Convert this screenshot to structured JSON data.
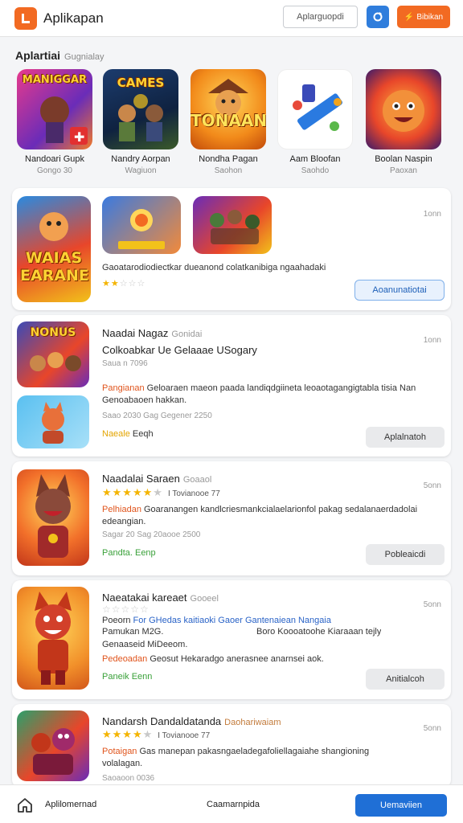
{
  "header": {
    "title": "Aplikapan",
    "search_placeholder": "Aplarguopdi",
    "cta_label": "Bibikan"
  },
  "section": {
    "title": "Aplartiai",
    "subtitle": "Gugnialay"
  },
  "featured": [
    {
      "name": "Nandoari Gupk",
      "sub": "Gongo 30",
      "art": "MANIGGAR"
    },
    {
      "name": "Nandry Aorpan",
      "sub": "Wagiuon",
      "art": "CAMES"
    },
    {
      "name": "Nondha Pagan",
      "sub": "Saohon",
      "art": "TONAAN"
    },
    {
      "name": "Aam Bloofan",
      "sub": "Saohdo",
      "art": ""
    },
    {
      "name": "Boolan Naspin",
      "sub": "Paoxan",
      "art": ""
    }
  ],
  "card1": {
    "time": "1onn",
    "big_art": "WAIAS EARANE",
    "small_art_1": "",
    "desc": "Gaoatarodiodiectkar dueanond colatkanibiga ngaahadaki",
    "stars": {
      "filled": "★★",
      "empty": "☆☆☆",
      "value": 2
    },
    "button": "Aoanunatiotai"
  },
  "card2": {
    "time": "1onn",
    "art_text": "NONUS",
    "title": "Naadai Nagaz",
    "title_muted": "Gonidai",
    "subtitle": "Colkoabkar Ue Gelaaae USogary",
    "meta": "Saua n 7096",
    "tag": "Pangianan",
    "desc1": "Geloaraen maeon paada landiqdgiineta leoaotagangigtabla tisia Nan",
    "desc2": "Genoabaoen hakkan.",
    "meta2": "Saao 2030 Gag Gegener 2250",
    "tag2": "Naeale",
    "tag2_text": "Eeqh",
    "button": "Aplalnatoh"
  },
  "card3": {
    "time": "5onn",
    "title": "Naadalai Saraen",
    "title_muted": "Goaaol",
    "stars": {
      "filled": "★★★★★",
      "empty": "★",
      "value": 5,
      "review": "I Tovianooe 77"
    },
    "tag": "Pelhiadan",
    "desc1": "Goaranangen kandlcriesmankcialaelarionfol pakag sedalanaerdadolai",
    "desc2": "edeangian.",
    "meta": "Sagar 20 Sag 20aooe 2500",
    "tag2": "Pandta. Eenp",
    "button": "Pobleaicdi"
  },
  "card4": {
    "time": "5onn",
    "title": "Naeatakai kareaet",
    "title_muted": "Gooeel",
    "stars": {
      "filled": "",
      "empty": "☆☆☆☆☆",
      "value": 0
    },
    "line1a": "Poeorn",
    "line1b": "For GHedas kaitiaoki Gaoer Gantenaiean Nangaia",
    "line2a": "Pamukan M2G.",
    "line2b": "Boro Koooatoohe Kiaraaan tejly",
    "line3": "Genaaseid MiDeeom.",
    "tag": "Pedeoadan",
    "desc": "Geosut Hekaradgo anerasnee anarnsei aok.",
    "tag2": "Paneik Eenn",
    "button": "Anitialcoh"
  },
  "card5": {
    "time": "5onn",
    "title": "Nandarsh Dandaldatanda",
    "title_muted": "Daohariwaiam",
    "stars": {
      "filled": "★★★★",
      "empty": "★",
      "value": 4,
      "review": "I Tovianooe 77"
    },
    "tag": "Potaigan",
    "desc1": "Gas manepan pakasngaeladegafoliellagaiahe shangioning",
    "desc2": "volalagan.",
    "meta": "Saoaoon 0036"
  },
  "bottom": {
    "left_label": "Aplilomernad",
    "center_label": "Caamarnpida",
    "button": "Uemaviien"
  },
  "colors": {
    "brand": "#f26a22",
    "accent": "#1f6fd6",
    "star": "#f4b400"
  }
}
